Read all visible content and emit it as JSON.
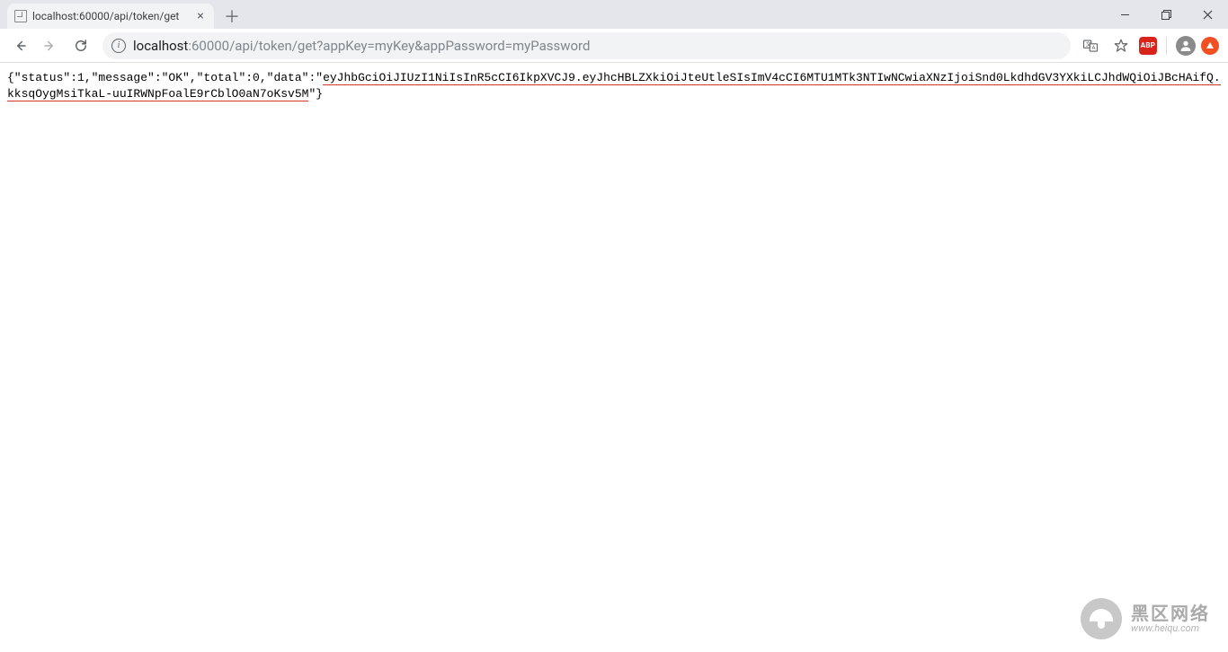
{
  "window": {
    "tab_title": "localhost:60000/api/token/get",
    "url_host": "localhost",
    "url_rest": ":60000/api/token/get?appKey=myKey&appPassword=myPassword"
  },
  "extensions": {
    "abp_label": "ABP"
  },
  "response": {
    "prefix": "{\"status\":1,\"message\":\"OK\",\"total\":0,\"data\":\"",
    "token": "eyJhbGciOiJIUzI1NiIsInR5cCI6IkpXVCJ9.eyJhcHBLZXkiOiJteUtleSIsImV4cCI6MTU1MTk3NTIwNCwiaXNzIjoiSnd0LkdhdGV3YXkiLCJhdWQiOiJBcHAifQ.kksqOygMsiTkaL-uuIRWNpFoalE9rCblO0aN7oKsv5M",
    "suffix": "\"}"
  },
  "watermark": {
    "cn": "黑区网络",
    "en": "www.heiqu.com"
  }
}
